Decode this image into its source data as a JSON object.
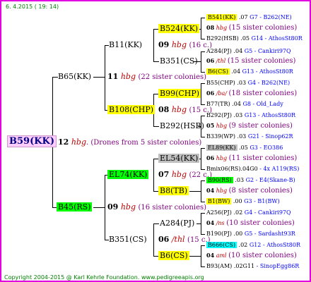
{
  "header": "6.  4.2015 ( 19: 14)",
  "footer": "Copyright 2004-2015 @ Karl Kehrle Foundation.   www.pedigreeapis.org",
  "root": {
    "label": "B59(KK)",
    "num": "12",
    "hbg": "hbg",
    "desc": ". (Drones from 5 sister colonies)"
  },
  "gen1": {
    "upper": {
      "label": "B65(KK)",
      "num": "11",
      "hbg": "hbg",
      "desc": "(22 sister colonies)"
    },
    "lower": {
      "label": "B45(RS)",
      "num": "09",
      "hbg": "hbg",
      "desc": "(16 sister colonies)"
    }
  },
  "gen2": {
    "a": {
      "label": "B11(KK)",
      "num": "09",
      "hbg": "hbg",
      "desc": "(16 c.)"
    },
    "b": {
      "label": "B108(CHP)",
      "num": "08",
      "hbg": "hbg",
      "desc": "(15 c.)"
    },
    "c": {
      "label": "EL74(KK)",
      "num": "07",
      "hbg": "hbg",
      "desc": "(22 c.)"
    },
    "d": {
      "label": "B351(CS)",
      "num": "06",
      "hbg": "/thl",
      "desc": "(15 c.)"
    }
  },
  "gen3": {
    "a1": {
      "label": "B524(KK)"
    },
    "a2": {
      "label": "B351(CS)"
    },
    "b1": {
      "label": "B99(CHP)"
    },
    "b2": {
      "label": "B292(HSB)"
    },
    "c1": {
      "label": "EL54(KK)"
    },
    "c2": {
      "label": "B8(TB)"
    },
    "d1": {
      "label": "A284(PJ)"
    },
    "d2": {
      "label": "B6(CS)"
    }
  },
  "gen4": [
    {
      "label": "B541(KK)",
      "val": ".07",
      "right": "G7 - B262(NE)"
    },
    {
      "num": "08",
      "hbg": "hbg",
      "desc": "(15 sister colonies)"
    },
    {
      "label": "B292(HSB)",
      "val": ".05",
      "right": "G14 - AthosSt80R"
    },
    {
      "label": "A284(PJ)",
      "val": ".04",
      "right": "G5 - Cankiri97Q"
    },
    {
      "num": "06",
      "hbg": "/thl",
      "desc": "(15 sister colonies)"
    },
    {
      "label": "B6(CS)",
      "val": ".04",
      "right": "G13 - AthosSt80R"
    },
    {
      "label": "B55(CHP)",
      "val": ".03",
      "right": "G4 - B262(NE)"
    },
    {
      "num": "06",
      "hbg": "/ba/",
      "desc": "(18 sister colonies)"
    },
    {
      "label": "B77(TR)",
      "val": ".04",
      "right": "G8 - Old_Lady"
    },
    {
      "label": "B292(PJ)",
      "val": ".03",
      "right": "G13 - AthosSt80R"
    },
    {
      "num": "05",
      "hbg": "hbg",
      "desc": "(9 sister colonies)"
    },
    {
      "label": "B339(WP)",
      "val": ".03",
      "right": "G21 - Sinop62R"
    },
    {
      "label": "EL89(KK)",
      "val": ".05",
      "right": "G3 - EO386"
    },
    {
      "num": "06",
      "hbg": "hbg",
      "desc": "(11 sister colonies)"
    },
    {
      "label": "Bmix06(RS)",
      "val": ".04G0",
      "right": "- 4x A119(RS)"
    },
    {
      "label": "B90(RS)",
      "val": ".03",
      "right": "G2 - E4(Skane-B)"
    },
    {
      "num": "04",
      "hbg": "hbg",
      "desc": "(8 sister colonies)"
    },
    {
      "label": "B1(BW)",
      "val": ".00",
      "right": "G3 - B1(BW)"
    },
    {
      "label": "A256(PJ)",
      "val": ".02",
      "right": "G4 - Cankiri97Q"
    },
    {
      "num": "04",
      "hbg": "/ns",
      "desc": "(10 sister colonies)"
    },
    {
      "label": "B190(PJ)",
      "val": ".00",
      "right": "G5 - Sardasht93R"
    },
    {
      "label": "B666(CS)",
      "val": ".02",
      "right": "G12 - AthosSt80R"
    },
    {
      "num": "04",
      "hbg": "aml",
      "desc": "(10 sister colonies)"
    },
    {
      "label": "B93(AM)",
      "val": ".02G11",
      "right": "- SinopEgg86R"
    }
  ]
}
